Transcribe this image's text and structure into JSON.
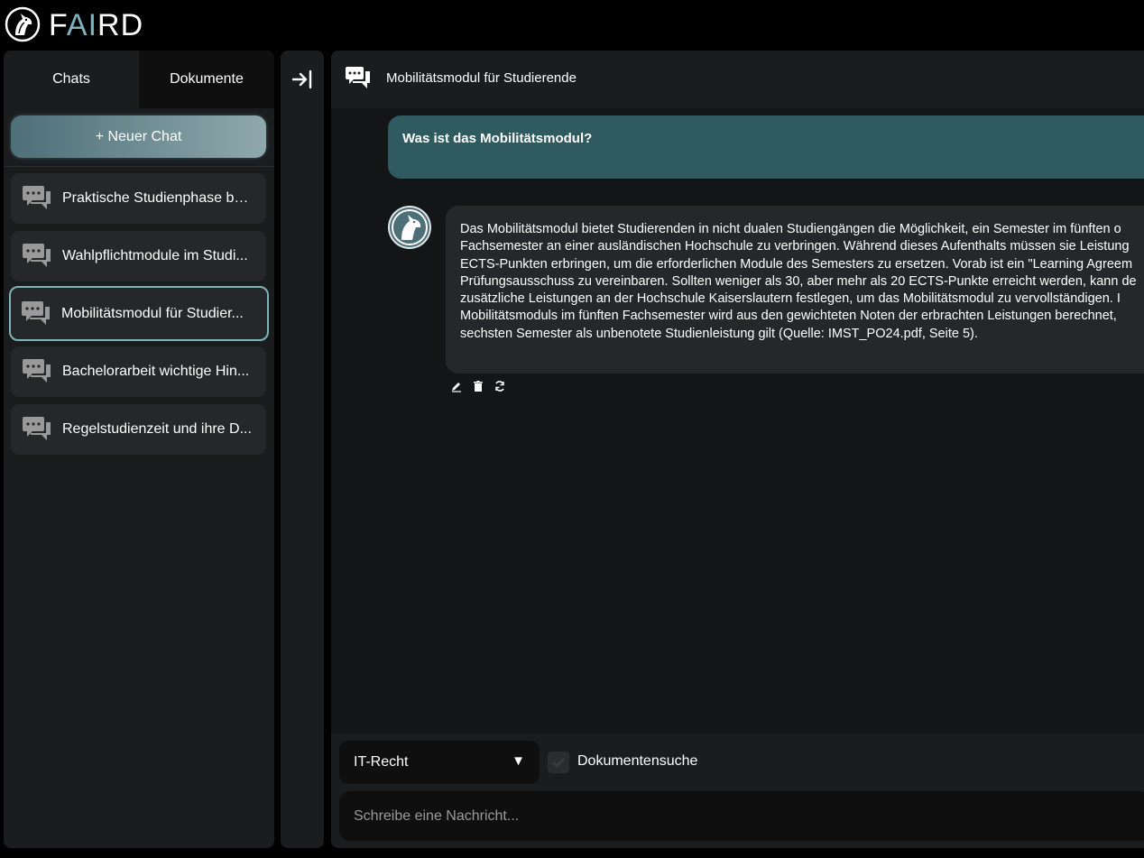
{
  "app": {
    "logo_text_f": "F",
    "logo_text_ai": "AI",
    "logo_text_rd": "RD"
  },
  "sidebar": {
    "tabs": [
      {
        "label": "Chats"
      },
      {
        "label": "Dokumente"
      }
    ],
    "new_chat_label": "+ Neuer Chat",
    "items": [
      {
        "label": "Praktische Studienphase be..."
      },
      {
        "label": "Wahlpflichtmodule im Studi..."
      },
      {
        "label": "Mobilitätsmodul für Studier..."
      },
      {
        "label": "Bachelorarbeit wichtige Hin..."
      },
      {
        "label": "Regelstudienzeit und ihre D..."
      }
    ]
  },
  "chat": {
    "title": "Mobilitätsmodul für Studierende",
    "user_message": "Was ist das Mobilitätsmodul?",
    "bot_lines": [
      "Das Mobilitätsmodul bietet Studierenden in nicht dualen Studiengängen die Möglichkeit, ein Semester im fünften o",
      "Fachsemester an einer ausländischen Hochschule zu verbringen. Während dieses Aufenthalts müssen sie Leistung",
      "ECTS-Punkten erbringen, um die erforderlichen Module des Semesters zu ersetzen. Vorab ist ein \"Learning Agreem",
      "Prüfungsausschuss zu vereinbaren. Sollten weniger als 30, aber mehr als 20 ECTS-Punkte erreicht werden, kann de",
      "zusätzliche Leistungen an der Hochschule Kaiserslautern festlegen, um das Mobilitätsmodul zu vervollständigen. I",
      "Mobilitätsmoduls im fünften Fachsemester wird aus den gewichteten Noten der erbrachten Leistungen berechnet,",
      "sechsten Semester als unbenotete Studienleistung gilt (Quelle: IMST_PO24.pdf, Seite 5)."
    ]
  },
  "footer": {
    "select_value": "IT-Recht",
    "select_caret": "▼",
    "checkbox_label": "Dokumentensuche",
    "input_placeholder": "Schreibe eine Nachricht..."
  },
  "colors": {
    "accent": "#2f5a5f",
    "active_border": "#7fb3b5",
    "panel": "#1b1c1e",
    "bubble": "#25272a"
  }
}
